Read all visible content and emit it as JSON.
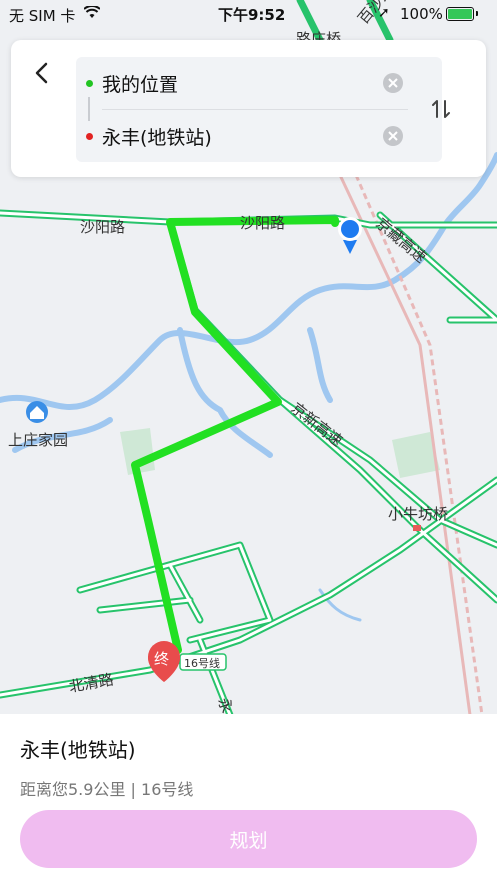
{
  "status_bar": {
    "carrier": "无 SIM 卡",
    "time": "下午9:52",
    "battery": "100%"
  },
  "route": {
    "origin": "我的位置",
    "destination": "永丰(地铁站)",
    "origin_color": "#22c422",
    "destination_color": "#e22222"
  },
  "map": {
    "labels": {
      "shayang_left": "沙阳路",
      "shayang_right": "沙阳路",
      "jingzang": "京藏高速",
      "jingxin": "京新高速",
      "xiaoniufang": "小牛坊桥",
      "shangzhuang": "上庄家园",
      "beiqing": "北清路",
      "line16": "16号线",
      "baisha": "百沙路",
      "luzhuang": "路庄桥",
      "yong": "永",
      "end_marker": "终"
    }
  },
  "destination_panel": {
    "title": "永丰(地铁站)",
    "subtitle": "距离您5.9公里 | 16号线",
    "plan_button": "规划"
  },
  "colors": {
    "route_line": "#22e022",
    "road": "#27c36b",
    "water": "#9fc7f0",
    "plan_button_bg": "#f0bcf0",
    "location_blue": "#1e7bf0",
    "end_marker_red": "#e84c4c"
  }
}
